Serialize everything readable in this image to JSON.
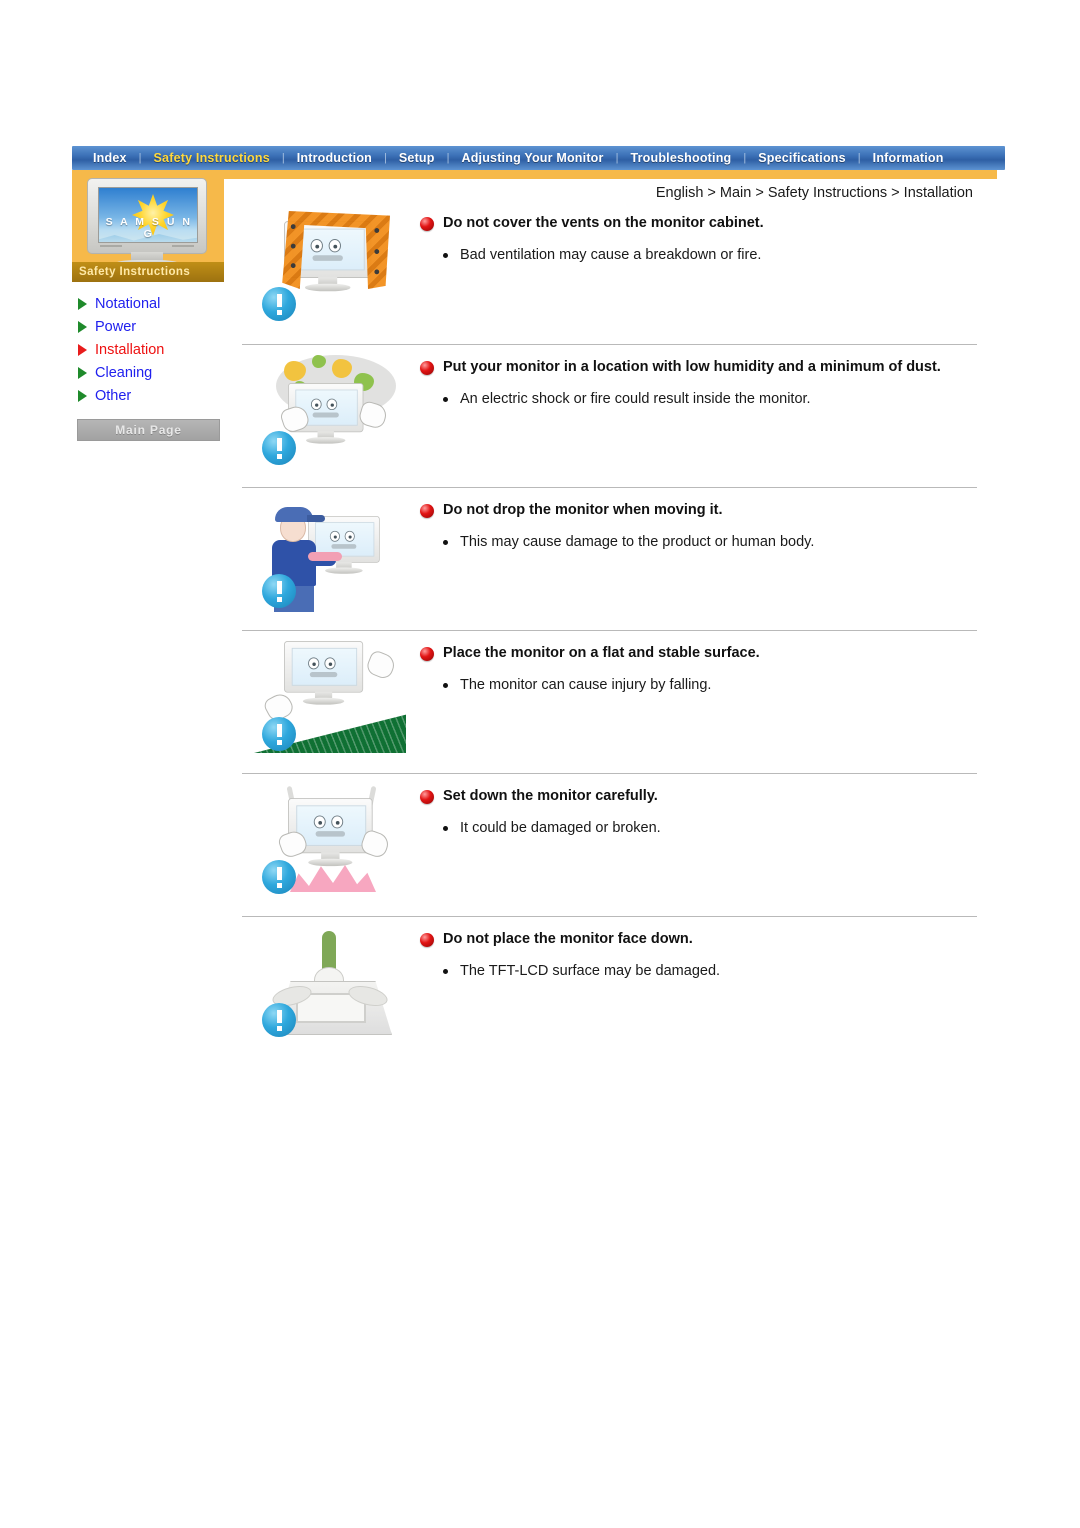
{
  "nav": {
    "items": [
      {
        "label": "Index",
        "active": false
      },
      {
        "label": "Safety Instructions",
        "active": true
      },
      {
        "label": "Introduction",
        "active": false
      },
      {
        "label": "Setup",
        "active": false
      },
      {
        "label": "Adjusting Your Monitor",
        "active": false
      },
      {
        "label": "Troubleshooting",
        "active": false
      },
      {
        "label": "Specifications",
        "active": false
      },
      {
        "label": "Information",
        "active": false
      }
    ],
    "separator": "|",
    "active_color": "#ffd83d",
    "bar_color": "#3a6fb5",
    "underbar_color": "#f6b94a"
  },
  "sidebar": {
    "brand_word": "S A M S U N G",
    "caption": "Safety Instructions",
    "items": [
      {
        "label": "Notational",
        "active": false
      },
      {
        "label": "Power",
        "active": false
      },
      {
        "label": "Installation",
        "active": true
      },
      {
        "label": "Cleaning",
        "active": false
      },
      {
        "label": "Other",
        "active": false
      }
    ],
    "main_page_button": "Main Page",
    "arrow_color": "#1f8a2b",
    "arrow_active_color": "#e81c1c",
    "link_color": "#2020ee",
    "link_active_color": "#ee1111"
  },
  "breadcrumb": "English > Main > Safety Instructions > Installation",
  "sections": [
    {
      "title": "Do not cover the vents on the monitor cabinet.",
      "bullets": [
        "Bad ventilation may cause a breakdown or fire."
      ],
      "illustration": "monitor-covered-with-blanket"
    },
    {
      "title": "Put your monitor in a location with low humidity and a minimum of dust.",
      "bullets": [
        "An electric shock or fire could result inside the monitor."
      ],
      "illustration": "monitor-in-dusty-environment"
    },
    {
      "title": "Do not drop the monitor when moving it.",
      "bullets": [
        "This may cause damage to the product or human body."
      ],
      "illustration": "person-carrying-monitor"
    },
    {
      "title": "Place the monitor on a flat and stable surface.",
      "bullets": [
        "The monitor can cause injury by falling."
      ],
      "illustration": "monitor-on-slope"
    },
    {
      "title": "Set down the monitor carefully.",
      "bullets": [
        "It could be damaged or broken."
      ],
      "illustration": "monitor-dropped-hard"
    },
    {
      "title": "Do not place the monitor face down.",
      "bullets": [
        "The TFT-LCD surface may be damaged."
      ],
      "illustration": "monitor-face-down"
    }
  ],
  "icons": {
    "warning": "exclamation-badge-icon",
    "section_marker": "red-sphere-bullet-icon",
    "bullet": "small-dot-bullet-icon"
  }
}
